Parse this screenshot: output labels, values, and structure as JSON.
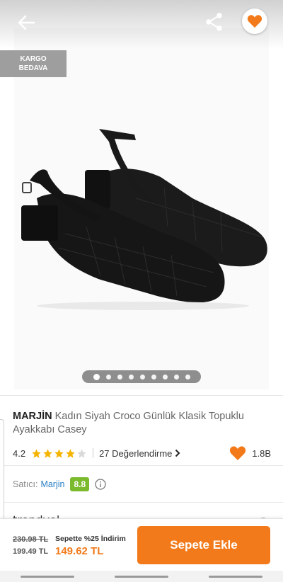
{
  "badge": {
    "line1": "KARGO",
    "line2": "BEDAVA"
  },
  "icons": {
    "back": "arrow-left-icon",
    "share": "share-icon",
    "favorite": "heart-icon",
    "info": "info-icon",
    "chevron": "chevron-right-icon"
  },
  "carousel": {
    "total": 9,
    "active": 0
  },
  "product": {
    "brand": "MARJİN",
    "name": "Kadın Siyah Croco Günlük Klasik Topuklu Ayakkabı Casey",
    "rating": "4.2",
    "rating_value": 4.2,
    "reviews": "27 Değerlendirme",
    "favorites": "1.8B"
  },
  "seller": {
    "label": "Satıcı:",
    "name": "Marjin",
    "score": "8.8"
  },
  "logo_peek": "trendyol",
  "pricing": {
    "old_price": "230.98 TL",
    "current_price": "199.49 TL",
    "promo": "Sepette %25 İndirim",
    "final_price": "149.62 TL"
  },
  "cart_button": "Sepete Ekle",
  "colors": {
    "accent": "#f27a1a",
    "seller_score": "#7cba2d",
    "link": "#2a7fc4",
    "star": "#f4b400"
  }
}
